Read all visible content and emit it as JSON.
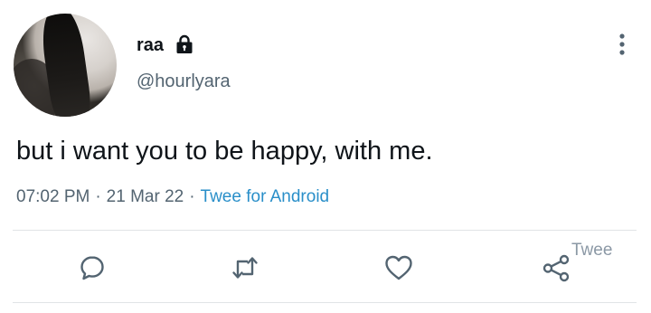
{
  "user": {
    "display_name": "raa",
    "handle": "@hourlyara",
    "protected_icon": "lock-icon"
  },
  "tweet": {
    "text": "but i want you to be happy, with me.",
    "time": "07:02 PM",
    "date": "21 Mar 22",
    "separator": "·",
    "source": "Twee for Android"
  },
  "actions": {
    "reply_icon": "reply-icon",
    "retweet_icon": "retweet-icon",
    "like_icon": "heart-icon",
    "share_icon": "share-icon"
  },
  "watermark": "Twee",
  "colors": {
    "text": "#0f1419",
    "secondary": "#536471",
    "link": "#2a8fc9",
    "divider": "#e1e4e6"
  }
}
